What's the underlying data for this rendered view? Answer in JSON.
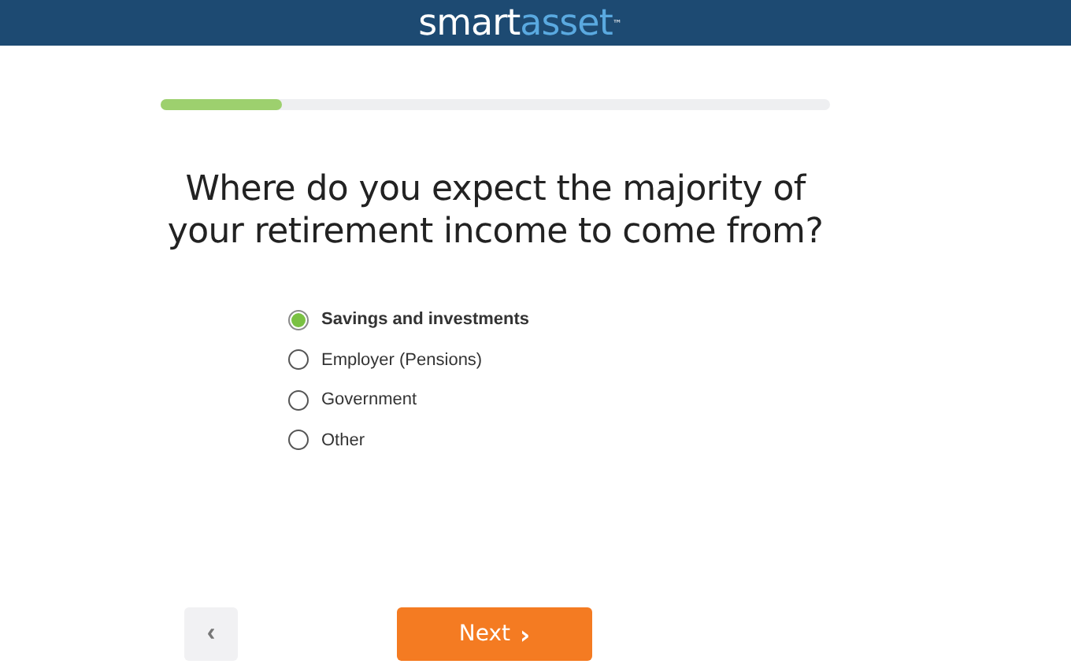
{
  "header": {
    "logo": {
      "part_1": "smart",
      "part_2": "asset",
      "trademark": "™"
    }
  },
  "progress": {
    "level": 0.18
  },
  "question": "Where do you expect the majority of your retirement income to come from?",
  "options": [
    {
      "label": "Savings and investments",
      "selected": true
    },
    {
      "label": "Employer (Pensions)",
      "selected": false
    },
    {
      "label": "Government",
      "selected": false
    },
    {
      "label": "Other",
      "selected": false
    }
  ],
  "buttons": {
    "back": {
      "label": "‹"
    },
    "next": {
      "label": "Next",
      "icon": "›"
    }
  }
}
